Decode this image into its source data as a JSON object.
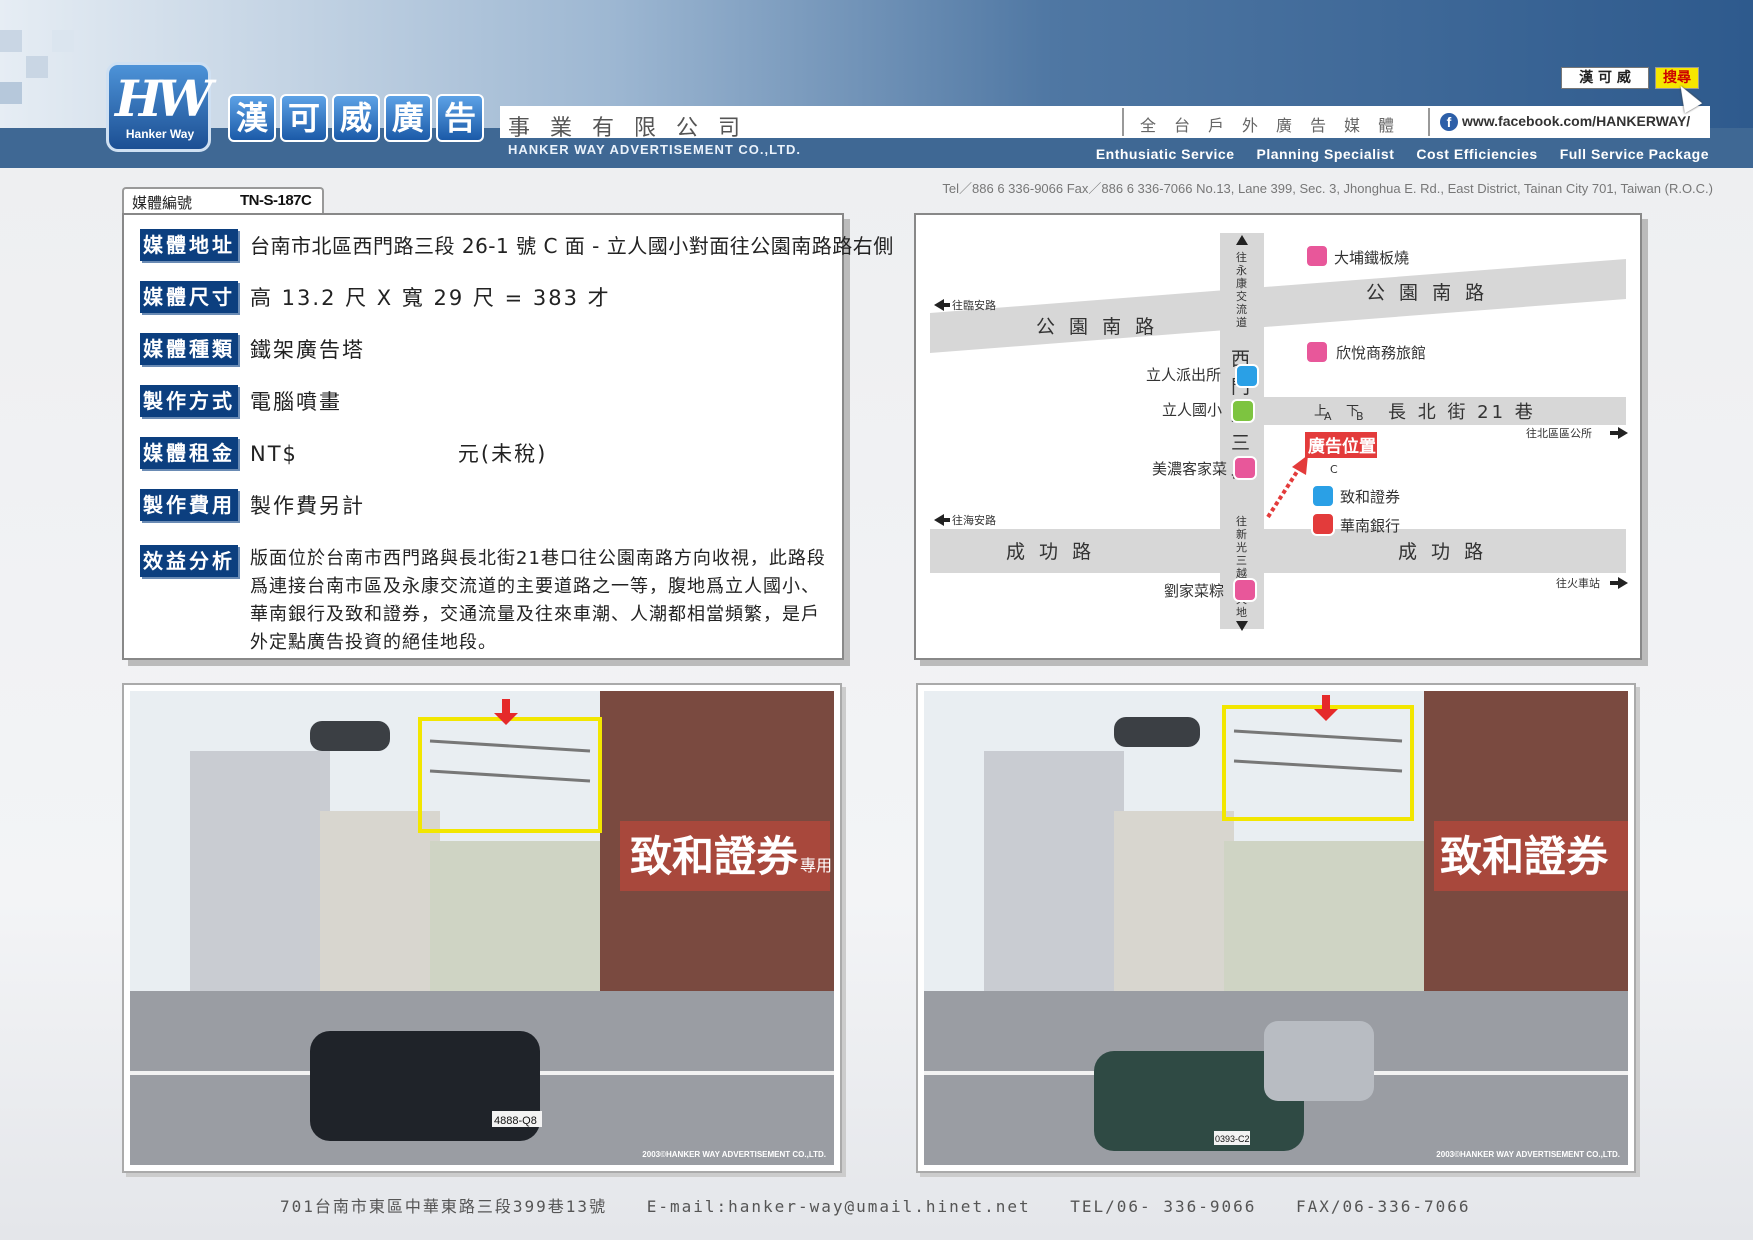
{
  "header": {
    "logo_text": "HW",
    "logo_sub": "Hanker Way",
    "title_chars": [
      "漢",
      "可",
      "威",
      "廣",
      "告"
    ],
    "company_suffix": "事業有限公司",
    "company_en": "HANKER WAY ADVERTISEMENT CO.,LTD.",
    "tagline": "全台戶外廣告媒體",
    "facebook_url": "www.facebook.com/HANKERWAY/",
    "search_value": "漢 可 威",
    "search_button": "搜尋",
    "services": [
      "Enthusiatic Service",
      "Planning Specialist",
      "Cost Efficiencies",
      "Full Service Package"
    ],
    "contact": "Tel／886 6 336-9066   Fax／886 6 336-7066   No.13, Lane 399, Sec. 3, Jhonghua E. Rd., East District, Tainan City 701, Taiwan (R.O.C.)"
  },
  "media": {
    "id_label": "媒體編號",
    "id_value": "TN-S-187C",
    "rows": [
      {
        "label": "媒體地址",
        "value": "台南市北區西門路三段 26-1 號 C 面 - 立人國小對面往公園南路路右側"
      },
      {
        "label": "媒體尺寸",
        "value": "高 13.2 尺 X 寬 29 尺 = 383 才"
      },
      {
        "label": "媒體種類",
        "value": "鐵架廣告塔"
      },
      {
        "label": "製作方式",
        "value": "電腦噴畫"
      },
      {
        "label": "媒體租金",
        "value": "NT$",
        "suffix": "元(未稅)"
      },
      {
        "label": "製作費用",
        "value": "製作費另計"
      },
      {
        "label": "效益分析",
        "value": "版面位於台南市西門路與長北街21巷口往公園南路方向收視，此路段爲連接台南市區及永康交流道的主要道路之一等，腹地爲立人國小、華南銀行及致和證券，交通流量及往來車潮、人潮都相當頻繁，是戶外定點廣告投資的絕佳地段。"
      }
    ]
  },
  "map": {
    "roads": {
      "gongyuan_left": "公 園 南 路",
      "gongyuan_right": "公 園 南 路",
      "changbei": "長 北 街 21 巷",
      "chenggong_left": "成   功   路",
      "chenggong_right": "成   功   路",
      "ximen": [
        "西",
        "門",
        "路",
        "三",
        "段"
      ],
      "north_dir": [
        "往",
        "永",
        "康",
        "交",
        "流",
        "道"
      ],
      "south_dir": [
        "往",
        "新",
        "光",
        "三",
        "越",
        "新",
        "天",
        "地"
      ]
    },
    "directions": {
      "linan": "往臨安路",
      "haian": "往海安路",
      "beiqu": "往北區區公所",
      "train": "往火車站"
    },
    "places": {
      "dapu": "大埔鐵板燒",
      "xinyue": "欣悅商務旅館",
      "liren_police": "立人派出所",
      "liren_school": "立人國小",
      "meinong": "美濃客家菜",
      "zhihe": "致和證券",
      "huanan": "華南銀行",
      "liujia": "劉家菜粽"
    },
    "faces": {
      "a": "A",
      "b": "B",
      "up": "上",
      "down": "下",
      "c": "C"
    },
    "ad_position": "廣告位置",
    "colors": {
      "pink": "#e8579a",
      "blue": "#2aa0e6",
      "green": "#7dc440",
      "red": "#e33b3b"
    }
  },
  "photos": {
    "copyright": "2003©HANKER WAY ADVERTISEMENT CO.,LTD.",
    "shop_sign": "致和證券",
    "shop_sign_suffix": "專用",
    "plate_left": "4888-Q8",
    "plate_right": "0393-C2"
  },
  "footer": {
    "address": "701台南市東區中華東路三段399巷13號",
    "email": "E-mail:hanker-way@umail.hinet.net",
    "tel": "TEL/06- 336-9066",
    "fax": "FAX/06-336-7066"
  }
}
